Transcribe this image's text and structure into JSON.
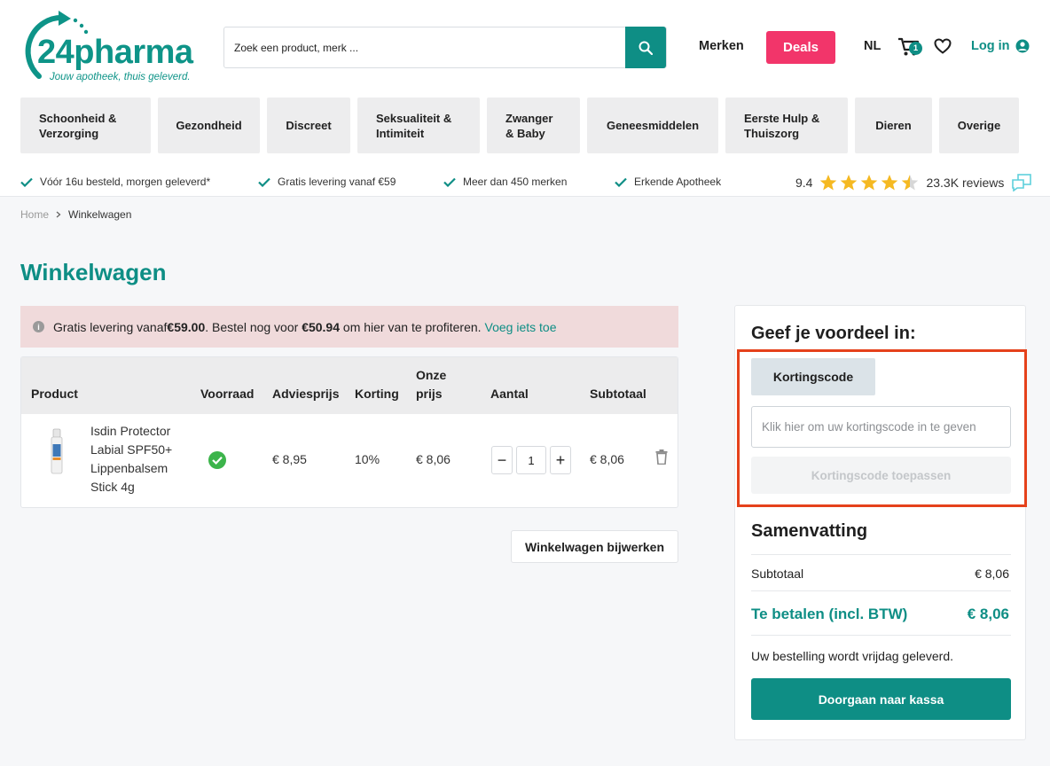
{
  "logo": {
    "name": "24pharma",
    "tagline": "Jouw apotheek, thuis geleverd."
  },
  "search": {
    "placeholder": "Zoek een product, merk ..."
  },
  "header": {
    "brands": "Merken",
    "deals": "Deals",
    "language": "NL",
    "cart_count": "1",
    "login": "Log in"
  },
  "categories": [
    {
      "label": "Schoonheid & Verzorging"
    },
    {
      "label": "Gezondheid"
    },
    {
      "label": "Discreet"
    },
    {
      "label": "Seksualiteit & Intimiteit"
    },
    {
      "label": "Zwanger & Baby"
    },
    {
      "label": "Geneesmiddelen"
    },
    {
      "label": "Eerste Hulp & Thuiszorg"
    },
    {
      "label": "Dieren"
    },
    {
      "label": "Overige"
    }
  ],
  "usps": [
    "Vóór 16u besteld, morgen geleverd*",
    "Gratis levering vanaf €59",
    "Meer dan 450 merken",
    "Erkende Apotheek"
  ],
  "rating": {
    "score": "9.4",
    "stars_value": 4.5,
    "reviews": "23.3K reviews"
  },
  "breadcrumb": {
    "home": "Home",
    "current": "Winkelwagen"
  },
  "page_title": "Winkelwagen",
  "notice": {
    "text1": "Gratis levering vanaf ",
    "amount1": "€59.00",
    "text2": ". Bestel nog voor ",
    "amount2": "€50.94",
    "text3": " om hier van te profiteren.",
    "link": "Voeg iets toe"
  },
  "table": {
    "headers": {
      "product": "Product",
      "stock": "Voorraad",
      "advice_price": "Adviesprijs",
      "discount": "Korting",
      "our_price_1": "Onze",
      "our_price_2": "prijs",
      "quantity": "Aantal",
      "subtotal": "Subtotaal"
    },
    "rows": [
      {
        "name_lines": [
          "Isdin Protector",
          "Labial SPF50+",
          "Lippenbalsem",
          "Stick 4g"
        ],
        "advice_price": "€ 8,95",
        "discount": "10%",
        "our_price": "€ 8,06",
        "quantity": "1",
        "subtotal": "€ 8,06"
      }
    ]
  },
  "update_button": "Winkelwagen bijwerken",
  "sidebar": {
    "voucher_title": "Geef je voordeel in:",
    "tab_label": "Kortingscode",
    "code_placeholder": "Klik hier om uw kortingscode in te geven",
    "apply_button": "Kortingscode toepassen",
    "summary_title": "Samenvatting",
    "subtotal_label": "Subtotaal",
    "subtotal_value": "€ 8,06",
    "total_label": "Te betalen (incl. BTW)",
    "total_value": "€ 8,06",
    "delivery_note": "Uw bestelling wordt vrijdag geleverd.",
    "checkout_button": "Doorgaan naar kassa"
  },
  "colors": {
    "brand": "#0e8e85",
    "deals": "#f2356a",
    "highlight": "#e5411b",
    "stars": "#f5b922"
  }
}
